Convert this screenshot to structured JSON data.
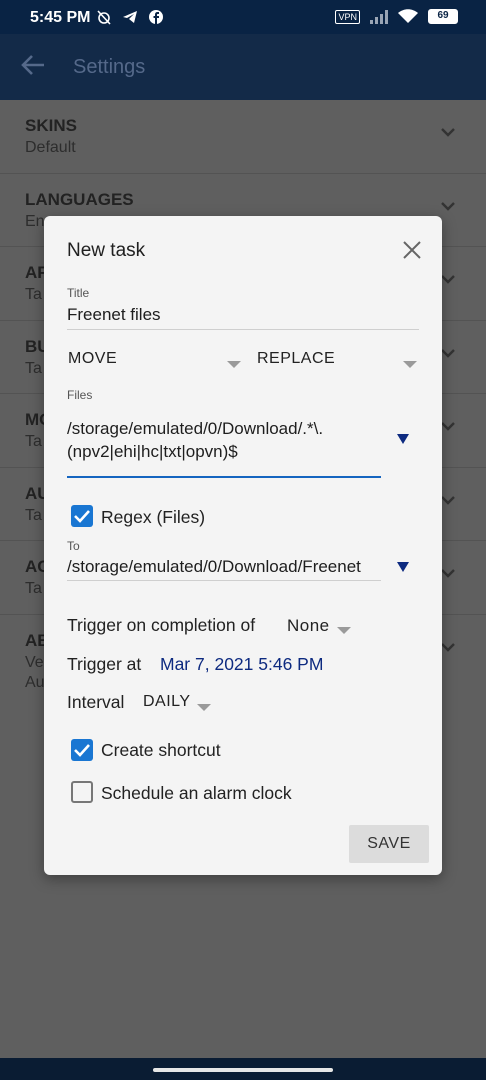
{
  "status_bar": {
    "time": "5:45 PM",
    "left_icons": [
      "alarm-off-icon",
      "telegram-icon",
      "facebook-icon"
    ],
    "vpn": "VPN",
    "battery": "69"
  },
  "app_bar": {
    "title": "Settings"
  },
  "settings": {
    "items": [
      {
        "title": "SKINS",
        "subtitle": "Default"
      },
      {
        "title": "LANGUAGES",
        "subtitle": "En"
      },
      {
        "title": "AF",
        "subtitle": "Ta"
      },
      {
        "title": "BU",
        "subtitle": "Ta"
      },
      {
        "title": "MO",
        "subtitle": "Ta"
      },
      {
        "title": "AU",
        "subtitle": "Ta"
      },
      {
        "title": "AC",
        "subtitle": "Ta"
      },
      {
        "title": "AB",
        "subtitle": "Ve",
        "subtitle2": "Au"
      }
    ]
  },
  "dialog": {
    "title": "New task",
    "title_label": "Title",
    "title_value": "Freenet files",
    "action": "MOVE",
    "mode": "REPLACE",
    "files_label": "Files",
    "files_line1": "/storage/emulated/0/Download/.*\\.",
    "files_line2": "(npv2|ehi|hc|txt|opvn)$",
    "regex_label": "Regex (Files)",
    "to_label": "To",
    "to_value": "/storage/emulated/0/Download/Freenet",
    "trigger_completion_label": "Trigger on completion of",
    "trigger_completion_value": "None",
    "trigger_at_label": "Trigger at",
    "trigger_at_value": "Mar 7, 2021 5:46 PM",
    "interval_label": "Interval",
    "interval_value": "DAILY",
    "shortcut_label": "Create shortcut",
    "alarm_label": "Schedule an alarm clock",
    "save_label": "SAVE"
  },
  "colors": {
    "accent": "#1976d2",
    "link": "#0d2a80",
    "status_bar": "#092344"
  }
}
